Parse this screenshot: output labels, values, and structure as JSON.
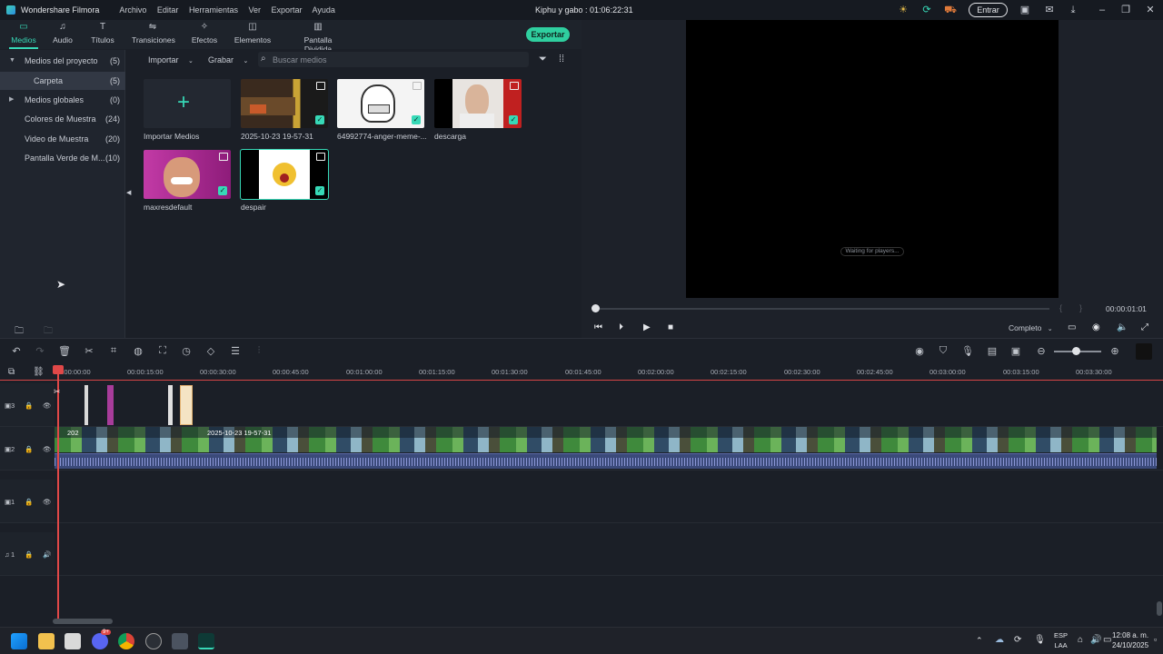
{
  "app": {
    "name": "Wondershare Filmora",
    "menu": [
      "Archivo",
      "Editar",
      "Herramientas",
      "Ver",
      "Exportar",
      "Ayuda"
    ],
    "project_title": "Kiphu y gabo : 01:06:22:31",
    "login_label": "Entrar"
  },
  "tabs": [
    {
      "label": "Medios",
      "icon": "media-icon"
    },
    {
      "label": "Audio",
      "icon": "audio-icon"
    },
    {
      "label": "Títulos",
      "icon": "titles-icon"
    },
    {
      "label": "Transiciones",
      "icon": "transitions-icon"
    },
    {
      "label": "Efectos",
      "icon": "effects-icon"
    },
    {
      "label": "Elementos",
      "icon": "elements-icon"
    },
    {
      "label": "Pantalla Dividida",
      "icon": "split-screen-icon"
    }
  ],
  "export_label": "Exportar",
  "library": [
    {
      "name": "Medios del proyecto",
      "count": "(5)"
    },
    {
      "name": "Carpeta",
      "count": "(5)"
    },
    {
      "name": "Medios globales",
      "count": "(0)"
    },
    {
      "name": "Colores de Muestra",
      "count": "(24)"
    },
    {
      "name": "Video de Muestra",
      "count": "(20)"
    },
    {
      "name": "Pantalla Verde de M...",
      "count": "(10)"
    }
  ],
  "media_toolbar": {
    "import_label": "Importar",
    "record_label": "Grabar",
    "search_placeholder": "Buscar medios"
  },
  "media_items": [
    {
      "name": "Importar Medios"
    },
    {
      "name": "2025-10-23 19-57-31"
    },
    {
      "name": "64992774-anger-meme-..."
    },
    {
      "name": "descarga"
    },
    {
      "name": "maxresdefault"
    },
    {
      "name": "despair"
    }
  ],
  "player": {
    "waiting_text": "Waiting for players...",
    "timecode": "00:00:01:01",
    "quality": "Completo"
  },
  "ruler": [
    "00:00:00:00",
    "00:00:15:00",
    "00:00:30:00",
    "00:00:45:00",
    "00:01:00:00",
    "00:01:15:00",
    "00:01:30:00",
    "00:01:45:00",
    "00:02:00:00",
    "00:02:15:00",
    "00:02:30:00",
    "00:02:45:00",
    "00:03:00:00",
    "00:03:15:00",
    "00:03:30:00"
  ],
  "tracks": [
    {
      "label": "3"
    },
    {
      "label": "2"
    },
    {
      "label": "1"
    },
    {
      "label": "1"
    }
  ],
  "clip_label": "2025-10-23 19-57-31",
  "clip_short": "202",
  "taskbar": {
    "lang_top": "ESP",
    "lang_bottom": "LAA",
    "time": "12:08 a. m.",
    "date": "24/10/2025",
    "discord_badge": "9+"
  },
  "colors": {
    "accent": "#37d9b7",
    "playhead": "#e04848",
    "export": "#2fcf9f"
  }
}
